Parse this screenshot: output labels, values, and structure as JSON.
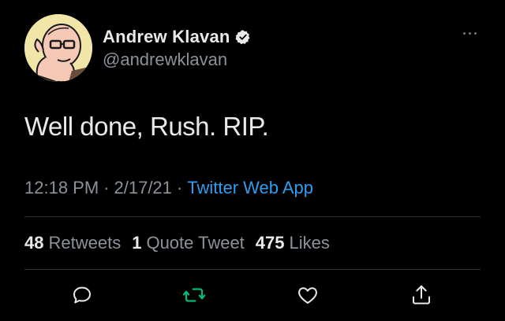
{
  "user": {
    "display_name": "Andrew Klavan",
    "handle": "@andrewklavan",
    "verified": true
  },
  "tweet": {
    "text": "Well done, Rush. RIP.",
    "time": "12:18 PM",
    "date": "2/17/21",
    "source": "Twitter Web App",
    "sep": "·"
  },
  "stats": {
    "retweets_count": "48",
    "retweets_label": "Retweets",
    "quotes_count": "1",
    "quotes_label": "Quote Tweet",
    "likes_count": "475",
    "likes_label": "Likes"
  },
  "colors": {
    "background": "#000000",
    "link": "#2e9df0",
    "retweet_green": "#00ba7c",
    "muted": "#8b9299"
  },
  "icons": {
    "reply": "speech-bubble-icon",
    "retweet": "retweet-arrows-icon",
    "like": "heart-icon",
    "share": "share-upload-icon",
    "more": "ellipsis-icon",
    "verified": "verified-badge-icon"
  }
}
